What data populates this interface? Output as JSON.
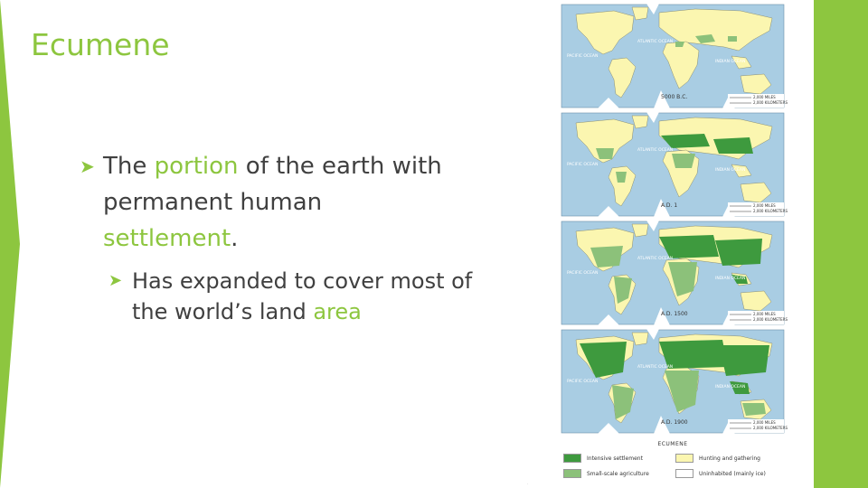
{
  "slide": {
    "title": "Ecumene",
    "bullet1": {
      "word1": "The",
      "word2": "portion",
      "word3": "of the earth with",
      "line2": "permanent human",
      "word4": "settlement",
      "period": "."
    },
    "bullet2": {
      "line1": "Has expanded to cover most of",
      "line2a": "the world’s land",
      "word": "area"
    }
  },
  "maps": [
    {
      "era": "5000 B.C.",
      "atlantic": "ATLANTIC OCEAN",
      "pacific": "PACIFIC OCEAN",
      "indian": "INDIAN OCEAN",
      "scale1": "2,000 MILES",
      "scale2": "2,000 KILOMETERS"
    },
    {
      "era": "A.D. 1",
      "atlantic": "ATLANTIC OCEAN",
      "pacific": "PACIFIC OCEAN",
      "indian": "INDIAN OCEAN",
      "scale1": "2,000 MILES",
      "scale2": "2,000 KILOMETERS"
    },
    {
      "era": "A.D. 1500",
      "atlantic": "ATLANTIC OCEAN",
      "pacific": "PACIFIC OCEAN",
      "indian": "INDIAN OCEAN",
      "scale1": "2,000 MILES",
      "scale2": "2,000 KILOMETERS"
    },
    {
      "era": "A.D. 1900",
      "atlantic": "ATLANTIC OCEAN",
      "pacific": "PACIFIC OCEAN",
      "indian": "INDIAN OCEAN",
      "scale1": "2,000 MILES",
      "scale2": "2,000 KILOMETERS"
    }
  ],
  "legend": {
    "title": "ECUMENE",
    "items": [
      {
        "label": "Intensive settlement",
        "color": "#3e9a3e"
      },
      {
        "label": "Hunting and gathering",
        "color": "#fbf6b0"
      },
      {
        "label": "Small-scale agriculture",
        "color": "#8cc17a"
      },
      {
        "label": "Uninhabited (mainly ice)",
        "color": "#ffffff"
      }
    ]
  },
  "colors": {
    "accent": "#8dc63f",
    "text": "#404040",
    "ocean": "#a9cde3",
    "land": "#fbf6b0",
    "intensive": "#3e9a3e",
    "small_scale": "#8cc17a"
  }
}
